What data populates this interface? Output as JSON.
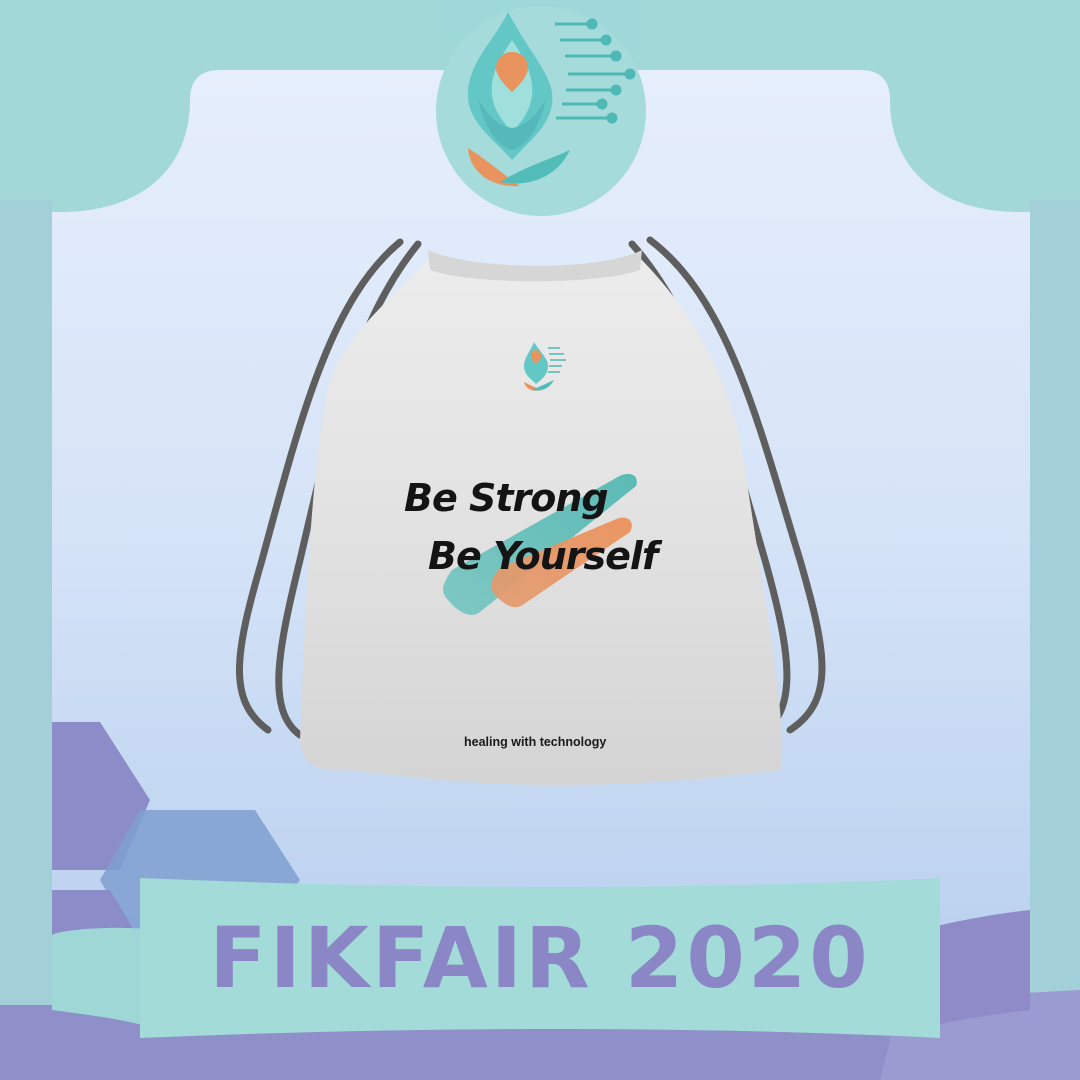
{
  "bag": {
    "headline_line1": "Be Strong",
    "headline_line2": "Be Yourself",
    "tagline": "healing with technology"
  },
  "banner": {
    "title": "FIKFAIR 2020"
  },
  "colors": {
    "teal": "#8fd3d2",
    "orange": "#e9935e",
    "purple": "#8b86c6",
    "panel": "#dbe6f8"
  },
  "icons": [
    "yoga-figure-logo-icon",
    "circuit-lines-icon"
  ]
}
